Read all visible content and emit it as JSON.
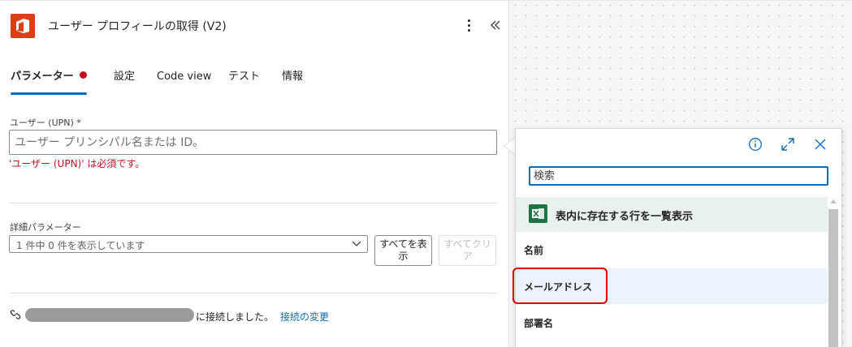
{
  "header": {
    "title": "ユーザー プロフィールの取得 (V2)"
  },
  "tabs": [
    {
      "label": "パラメーター",
      "active": true,
      "required": true
    },
    {
      "label": "設定"
    },
    {
      "label": "Code view"
    },
    {
      "label": "テスト"
    },
    {
      "label": "情報"
    }
  ],
  "upn": {
    "label": "ユーザー (UPN) *",
    "placeholder": "ユーザー プリンシパル名または ID。",
    "value": "",
    "error": "'ユーザー (UPN)' は必須です。"
  },
  "advanced": {
    "label": "詳細パラメーター",
    "selected": "1 件中 0 件を表示しています",
    "show_all": "すべてを表示",
    "clear_all": "すべてクリア"
  },
  "connection": {
    "text": "に接続しました。",
    "change": "接続の変更"
  },
  "dropdown": {
    "search_placeholder": "検索",
    "group_label": "表内に存在する行を一覧表示",
    "items": [
      {
        "label": "名前"
      },
      {
        "label": "メールアドレス",
        "highlighted": true
      },
      {
        "label": "部署名"
      }
    ]
  },
  "colors": {
    "accent": "#0f6cbd",
    "error": "#c50f1f",
    "office_brand": "#dc3e15",
    "excel_brand": "#1d7344",
    "highlight_outline": "#e00000"
  },
  "icons": {
    "app": "office-logo-icon",
    "more": "more-vertical-icon",
    "collapse": "double-chevron-left-icon",
    "info": "info-icon",
    "expand": "expand-icon",
    "close": "close-icon",
    "excel": "excel-icon",
    "connection": "link-icon",
    "select_arrow": "chevron-down-icon"
  }
}
